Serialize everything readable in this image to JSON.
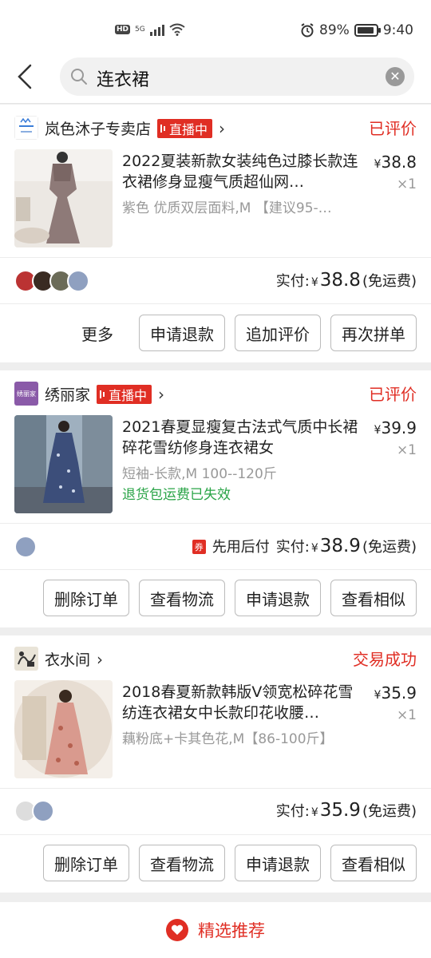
{
  "status_bar": {
    "network": "HD",
    "signal": "5G",
    "battery": "89%",
    "battery_level": 0.89,
    "time": "9:40"
  },
  "search": {
    "query": "连衣裙"
  },
  "orders": [
    {
      "shop": "岚色沐子专卖店",
      "live_label": "直播中",
      "status": "已评价",
      "title": "2022夏装新款女装纯色过膝长款连衣裙修身显瘦气质超仙网…",
      "price": "38.8",
      "currency": "¥",
      "qty": "×1",
      "spec": "紫色 优质双层面料,M 【建议95-…",
      "paid_label": "实付:",
      "paid": "38.8",
      "shipping": "(免运费)",
      "more_label": "更多",
      "buttons": [
        "申请退款",
        "追加评价",
        "再次拼单"
      ]
    },
    {
      "shop": "绣丽家",
      "shop_logo_text": "绣丽家",
      "live_label": "直播中",
      "status": "已评价",
      "title": "2021春夏显瘦复古法式气质中长裙碎花雪纺修身连衣裙女",
      "price": "39.9",
      "currency": "¥",
      "qty": "×1",
      "spec": "短袖-长款,M 100--120斤",
      "note": "退货包运费已失效",
      "coupon": "券",
      "pay_later": "先用后付",
      "paid_label": "实付:",
      "paid": "38.9",
      "shipping": "(免运费)",
      "buttons": [
        "删除订单",
        "查看物流",
        "申请退款",
        "查看相似"
      ]
    },
    {
      "shop": "衣水间",
      "status": "交易成功",
      "title": "2018春夏新款韩版V领宽松碎花雪纺连衣裙女中长款印花收腰…",
      "price": "35.9",
      "currency": "¥",
      "qty": "×1",
      "spec": "藕粉底+卡其色花,M【86-100斤】",
      "paid_label": "实付:",
      "paid": "35.9",
      "shipping": "(免运费)",
      "buttons": [
        "删除订单",
        "查看物流",
        "申请退款",
        "查看相似"
      ]
    }
  ],
  "recommend": {
    "label": "精选推荐"
  },
  "colors": {
    "accent": "#e02e24",
    "green": "#2aa447"
  }
}
